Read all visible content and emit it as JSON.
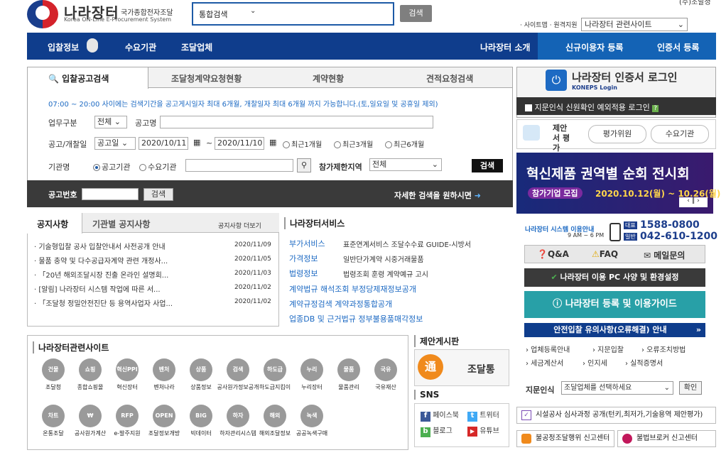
{
  "header": {
    "logo_title": "나라장터",
    "logo_sub": "국가종합전자조달",
    "logo_eng": "Korea ON-Line E-Procurement System",
    "search_scope": "통합검색",
    "search_button": "검색",
    "top_right_cut": "(주)조달청",
    "sitemap_label": "· 사이트맵 · 원격지원",
    "related_sites_select": "나라장터 관련사이트"
  },
  "nav": {
    "items": [
      "입찰정보",
      "수요기관",
      "조달업체"
    ],
    "right_items": [
      "나라장터 소개",
      "신규이용자 등록",
      "인증서 등록"
    ]
  },
  "search_tabs": [
    "입찰공고검색",
    "조달청계약요청현황",
    "계약현황",
    "견적요청검색"
  ],
  "search_form": {
    "notice": "07:00 ~ 20:00 사이에는 검색기간을 공고게시일자 최대 6개월, 개찰일자 최대 6개월 까지 가능합니다.(토,일요일 및 공휴일 제외)",
    "biz_type_label": "업무구분",
    "biz_type_value": "전체",
    "title_label": "공고명",
    "date_label": "공고/개찰일",
    "date_type_value": "공고일",
    "date_from": "2020/10/11",
    "date_to": "2020/11/10",
    "tilde": "~",
    "period_options": [
      "최근1개월",
      "최근3개월",
      "최근6개월"
    ],
    "org_label": "기관명",
    "org_options": [
      "공고기관",
      "수요기관"
    ],
    "region_label": "참가제한지역",
    "region_value": "전체",
    "search_button": "검색",
    "bid_no_label": "공고번호",
    "bid_no_button": "검색",
    "advanced_text": "자세한 검색을 원하시면"
  },
  "notice": {
    "tabs": [
      "공지사항",
      "기관별 공지사항"
    ],
    "more": "공지사항 더보기",
    "items": [
      {
        "title": "· 기술형입찰 공사 입찰안내서 사전공개 안내",
        "date": "2020/11/09"
      },
      {
        "title": "· 물품 충약 및 다수공급자계약 관련 개정사...",
        "date": "2020/11/05"
      },
      {
        "title": "· 「20년 해외조달시장 진출 온라인 설명회...",
        "date": "2020/11/03"
      },
      {
        "title": "· [알림] 나라장터 시스템 작업에 따른 서...",
        "date": "2020/11/02"
      },
      {
        "title": "· 「조달청 정밀안전진단 등 용역사업자 사업...",
        "date": "2020/11/02"
      }
    ]
  },
  "services": {
    "title": "나라장터서비스",
    "rows": [
      {
        "key": "부가서비스",
        "value": "표준연계서비스 조달수수료 GUIDE-시방서"
      },
      {
        "key": "가격정보",
        "value": "일반단가계약 시중거래물품"
      },
      {
        "key": "법령정보",
        "value": "법령조회  훈령  계약예규  고시"
      }
    ],
    "extra_rows": [
      "계약법규 해석조회   부정당제재정보공개",
      "계약규정검색   계약과정통합공개",
      "업종DB 및 근거법규   정부불용품매각정보"
    ]
  },
  "related": {
    "title": "나라장터관련사이트",
    "row1": [
      {
        "icon": "건물",
        "label": "조달청"
      },
      {
        "icon": "쇼핑",
        "label": "종합쇼핑몰"
      },
      {
        "icon": "혁신PPI",
        "label": "혁신장터"
      },
      {
        "icon": "벤처",
        "label": "벤처나라"
      },
      {
        "icon": "상품",
        "label": "상품정보"
      },
      {
        "icon": "검색",
        "label": "공사원가정보공개"
      },
      {
        "icon": "하도급",
        "label": "하도급지킴이"
      },
      {
        "icon": "누리",
        "label": "누리장터"
      },
      {
        "icon": "물품",
        "label": "물품관리"
      },
      {
        "icon": "국유",
        "label": "국유재산"
      }
    ],
    "row2": [
      {
        "icon": "차트",
        "label": "온통조달"
      },
      {
        "icon": "₩",
        "label": "공사원가계산"
      },
      {
        "icon": "RFP",
        "label": "e-발주지원"
      },
      {
        "icon": "OPEN",
        "label": "조달정보개방"
      },
      {
        "icon": "BIG",
        "label": "빅데이터"
      },
      {
        "icon": "하자",
        "label": "하자관리시스템"
      },
      {
        "icon": "해외",
        "label": "해외조달정보"
      },
      {
        "icon": "녹색",
        "label": "공공녹색구매"
      }
    ]
  },
  "proposal": {
    "title": "제안게시판",
    "banner_badge": "通",
    "banner_text": "조달통",
    "sns_title": "SNS",
    "sns": [
      "페이스북",
      "트위터",
      "블로그",
      "유튜브"
    ]
  },
  "right": {
    "login_title": "나라장터 인증서 로그인",
    "koneps_login": "KONEPS Login",
    "biometric": "지문인식 신원확인 예외적용 로그인",
    "eval_badge": "제안서 평가",
    "eval_buttons": [
      "평가위원",
      "수요기관"
    ],
    "banner_title": "혁신제품 권역별 순회 전시회",
    "banner_tag": "참가기업 모집",
    "banner_dates": "2020.10.12(월) ~ 10.26(월)",
    "hours_label": "나라장터 시스템 이용안내",
    "hours": "9 AM ~ 6 PM",
    "phone_tag1": "대표",
    "phone1": "1588-0800",
    "phone_tag2": "일반",
    "phone2": "042-610-1200",
    "faq_items": [
      "Q&A",
      "FAQ",
      "메일문의"
    ],
    "env_button": "나라장터 이용 PC 사양 및 환경설정",
    "guide_button": "나라장터 등록 및 이용가이드",
    "safe_button": "안전입찰 유의사항(오류해결) 안내",
    "links": [
      "› 업체등록안내",
      "› 지문입찰",
      "› 오류조치방법",
      "› 세금계산서",
      "› 인지세",
      "› 실적증명서"
    ],
    "biometric_label": "지문인식",
    "biz_select": "조달업체를 선택하세요",
    "confirm": "확인",
    "wide_link": "시설공사 심사과정 공개(턴키,최저가,기술용역 제안평가)",
    "bottom_links": [
      "불공정조달행위 신고센터",
      "불법브로커 신고센터"
    ]
  },
  "colors": {
    "navy": "#0f3d8c",
    "blue": "#1463b5",
    "teal": "#28a0a7",
    "link": "#1d6ac3"
  }
}
